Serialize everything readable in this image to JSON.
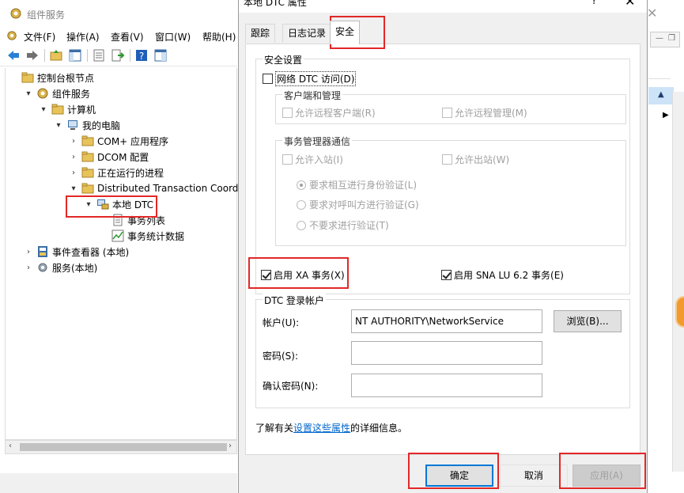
{
  "background_window": {
    "title": "组件服务",
    "menu": [
      "文件(F)",
      "操作(A)",
      "查看(V)",
      "窗口(W)",
      "帮助(H)"
    ],
    "tree": [
      {
        "label": "控制台根节点",
        "indent": 0,
        "arrow": "",
        "icon": "folder-icon"
      },
      {
        "label": "组件服务",
        "indent": 1,
        "arrow": "▾",
        "icon": "component-services-icon"
      },
      {
        "label": "计算机",
        "indent": 2,
        "arrow": "▾",
        "icon": "folder-icon"
      },
      {
        "label": "我的电脑",
        "indent": 3,
        "arrow": "▾",
        "icon": "my-computer-icon"
      },
      {
        "label": "COM+ 应用程序",
        "indent": 4,
        "arrow": "›",
        "icon": "folder-icon"
      },
      {
        "label": "DCOM 配置",
        "indent": 4,
        "arrow": "›",
        "icon": "folder-icon"
      },
      {
        "label": "正在运行的进程",
        "indent": 4,
        "arrow": "›",
        "icon": "folder-icon"
      },
      {
        "label": "Distributed Transaction Coordina",
        "indent": 4,
        "arrow": "▾",
        "icon": "folder-icon"
      },
      {
        "label": "本地 DTC",
        "indent": 5,
        "arrow": "▾",
        "icon": "local-dtc-icon"
      },
      {
        "label": "事务列表",
        "indent": 6,
        "arrow": "",
        "icon": "transaction-list-icon"
      },
      {
        "label": "事务统计数据",
        "indent": 6,
        "arrow": "",
        "icon": "statistics-icon"
      },
      {
        "label": "事件查看器 (本地)",
        "indent": 1,
        "arrow": "›",
        "icon": "event-viewer-icon"
      },
      {
        "label": "服务(本地)",
        "indent": 1,
        "arrow": "›",
        "icon": "services-gear-icon"
      }
    ]
  },
  "dialog": {
    "title": "本地 DTC 属性",
    "help": "?",
    "close": "✕",
    "tabs": [
      "跟踪",
      "日志记录",
      "安全"
    ],
    "security": {
      "group_title": "安全设置",
      "network_dtc_access": "网络 DTC 访问(D)",
      "client_admin": {
        "title": "客户端和管理",
        "allow_remote_clients": "允许远程客户端(R)",
        "allow_remote_admin": "允许远程管理(M)"
      },
      "tm_comm": {
        "title": "事务管理器通信",
        "allow_inbound": "允许入站(I)",
        "allow_outbound": "允许出站(W)",
        "radio_mutual": "要求相互进行身份验证(L)",
        "radio_caller": "要求对呼叫方进行验证(G)",
        "radio_none": "不要求进行验证(T)"
      },
      "enable_xa": "启用 XA 事务(X)",
      "enable_sna": "启用 SNA LU 6.2 事务(E)"
    },
    "logon": {
      "group_title": "DTC 登录帐户",
      "account_label": "帐户(U):",
      "account_value": "NT AUTHORITY\\NetworkService",
      "browse": "浏览(B)...",
      "password_label": "密码(S):",
      "confirm_label": "确认密码(N):"
    },
    "info_prefix": "了解有关",
    "info_link": "设置这些属性",
    "info_suffix": "的详细信息。",
    "buttons": {
      "ok": "确定",
      "cancel": "取消",
      "apply": "应用(A)"
    }
  }
}
